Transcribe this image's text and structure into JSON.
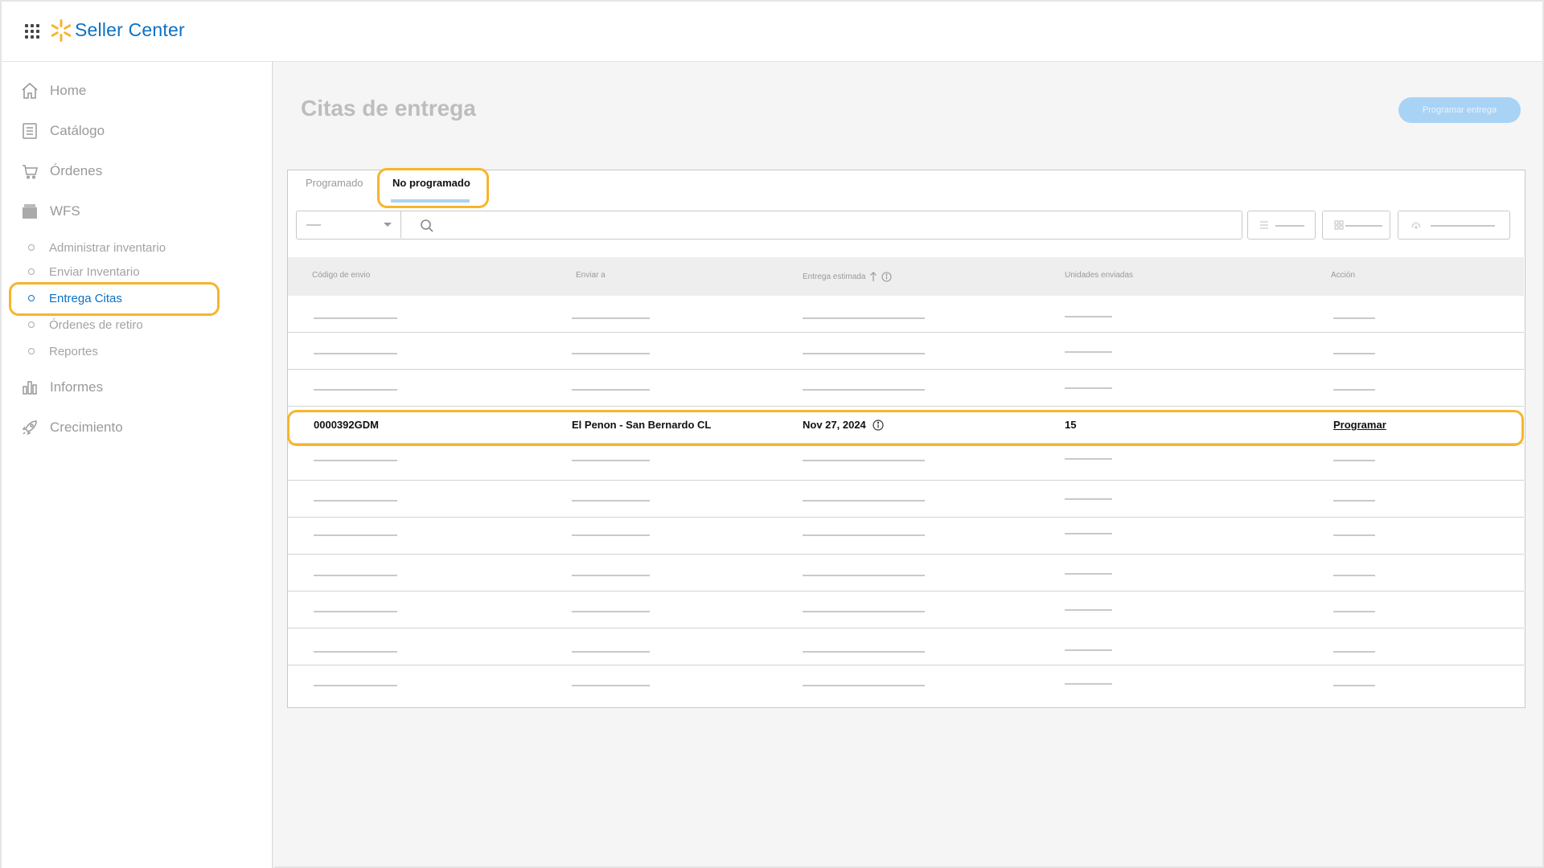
{
  "header": {
    "brand": "Seller Center",
    "apps_icon": "apps-grid-icon",
    "logo_icon": "spark-logo-icon",
    "brand_color": "#0c71c3"
  },
  "sidebar": {
    "items": [
      {
        "label": "Home",
        "icon": "home-icon"
      },
      {
        "label": "Catálogo",
        "icon": "catalog-icon"
      },
      {
        "label": "Órdenes",
        "icon": "cart-icon"
      },
      {
        "label": "WFS",
        "icon": "box-icon"
      }
    ],
    "wfs_sub": [
      {
        "label": "Administrar inventario"
      },
      {
        "label": "Enviar Inventario"
      },
      {
        "label": "Entrega Citas",
        "active": true
      },
      {
        "label": "Órdenes de retiro"
      },
      {
        "label": "Reportes"
      }
    ],
    "bottom_items": [
      {
        "label": "Informes",
        "icon": "bar-chart-icon"
      },
      {
        "label": "Crecimiento",
        "icon": "rocket-icon"
      }
    ]
  },
  "main": {
    "title": "Citas de entrega",
    "primary_button": "Programar entrega",
    "tabs": [
      {
        "label": "Programado",
        "active": false
      },
      {
        "label": "No programado",
        "active": true
      }
    ],
    "table": {
      "columns": [
        "Código de envio",
        "Enviar a",
        "Entrega estimada",
        "Unidades enviadas",
        "Acción"
      ],
      "highlight_row": {
        "code": "0000392GDM",
        "ship_to": "El Penon - San Bernardo CL",
        "date": "Nov 27, 2024",
        "units": "15",
        "action": "Programar"
      }
    }
  },
  "colors": {
    "highlight": "#f7b52c",
    "accent": "#0c71c3",
    "tab_underline": "#a9d3f5"
  }
}
